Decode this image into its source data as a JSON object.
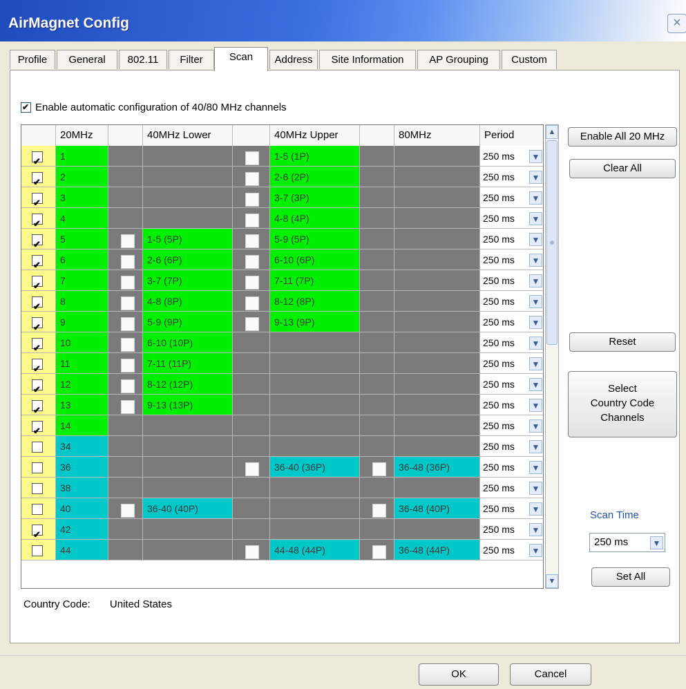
{
  "window": {
    "title": "AirMagnet Config",
    "close_glyph": "×"
  },
  "tabs": [
    {
      "label": "Profile"
    },
    {
      "label": "General"
    },
    {
      "label": "802.11"
    },
    {
      "label": "Filter"
    },
    {
      "label": "Scan",
      "active": true
    },
    {
      "label": "Address"
    },
    {
      "label": "Site Information"
    },
    {
      "label": "AP Grouping"
    },
    {
      "label": "Custom"
    }
  ],
  "scan": {
    "auto_config": {
      "label": "Enable automatic configuration of 40/80 MHz channels",
      "checked": true
    },
    "columns": [
      "20MHz",
      "40MHz Lower",
      "40MHz Upper",
      "80MHz",
      "Period"
    ],
    "rows": [
      {
        "enabled": true,
        "ch": "1",
        "lower": "",
        "upper": "1-5 (1P)",
        "mhz80": "",
        "period": "250 ms",
        "color": "green"
      },
      {
        "enabled": true,
        "ch": "2",
        "lower": "",
        "upper": "2-6 (2P)",
        "mhz80": "",
        "period": "250 ms",
        "color": "green"
      },
      {
        "enabled": true,
        "ch": "3",
        "lower": "",
        "upper": "3-7 (3P)",
        "mhz80": "",
        "period": "250 ms",
        "color": "green"
      },
      {
        "enabled": true,
        "ch": "4",
        "lower": "",
        "upper": "4-8 (4P)",
        "mhz80": "",
        "period": "250 ms",
        "color": "green"
      },
      {
        "enabled": true,
        "ch": "5",
        "lower": "1-5 (5P)",
        "upper": "5-9 (5P)",
        "mhz80": "",
        "period": "250 ms",
        "color": "green"
      },
      {
        "enabled": true,
        "ch": "6",
        "lower": "2-6 (6P)",
        "upper": "6-10 (6P)",
        "mhz80": "",
        "period": "250 ms",
        "color": "green"
      },
      {
        "enabled": true,
        "ch": "7",
        "lower": "3-7 (7P)",
        "upper": "7-11 (7P)",
        "mhz80": "",
        "period": "250 ms",
        "color": "green"
      },
      {
        "enabled": true,
        "ch": "8",
        "lower": "4-8 (8P)",
        "upper": "8-12 (8P)",
        "mhz80": "",
        "period": "250 ms",
        "color": "green"
      },
      {
        "enabled": true,
        "ch": "9",
        "lower": "5-9 (9P)",
        "upper": "9-13 (9P)",
        "mhz80": "",
        "period": "250 ms",
        "color": "green"
      },
      {
        "enabled": true,
        "ch": "10",
        "lower": "6-10 (10P)",
        "upper": "",
        "mhz80": "",
        "period": "250 ms",
        "color": "green"
      },
      {
        "enabled": true,
        "ch": "11",
        "lower": "7-11 (11P)",
        "upper": "",
        "mhz80": "",
        "period": "250 ms",
        "color": "green"
      },
      {
        "enabled": true,
        "ch": "12",
        "lower": "8-12 (12P)",
        "upper": "",
        "mhz80": "",
        "period": "250 ms",
        "color": "green"
      },
      {
        "enabled": true,
        "ch": "13",
        "lower": "9-13 (13P)",
        "upper": "",
        "mhz80": "",
        "period": "250 ms",
        "color": "green"
      },
      {
        "enabled": true,
        "ch": "14",
        "lower": "",
        "upper": "",
        "mhz80": "",
        "period": "250 ms",
        "color": "green"
      },
      {
        "enabled": false,
        "ch": "34",
        "lower": "",
        "upper": "",
        "mhz80": "",
        "period": "250 ms",
        "color": "teal"
      },
      {
        "enabled": false,
        "ch": "36",
        "lower": "",
        "upper": "36-40 (36P)",
        "mhz80": "36-48 (36P)",
        "period": "250 ms",
        "color": "teal"
      },
      {
        "enabled": false,
        "ch": "38",
        "lower": "",
        "upper": "",
        "mhz80": "",
        "period": "250 ms",
        "color": "teal"
      },
      {
        "enabled": false,
        "ch": "40",
        "lower": "36-40 (40P)",
        "upper": "",
        "mhz80": "36-48 (40P)",
        "period": "250 ms",
        "color": "teal"
      },
      {
        "enabled": true,
        "ch": "42",
        "lower": "",
        "upper": "",
        "mhz80": "",
        "period": "250 ms",
        "color": "teal"
      },
      {
        "enabled": false,
        "ch": "44",
        "lower": "",
        "upper": "44-48 (44P)",
        "mhz80": "36-48 (44P)",
        "period": "250 ms",
        "color": "teal"
      }
    ],
    "buttons": {
      "enable_all": "Enable All 20 MHz",
      "clear_all": "Clear All",
      "reset": "Reset",
      "select_country_line1": "Select",
      "select_country_line2": "Country Code",
      "select_country_line3": "Channels",
      "set_all": "Set All"
    },
    "scan_time": {
      "label": "Scan Time",
      "value": "250 ms"
    },
    "country": {
      "label": "Country Code:",
      "value": "United States"
    }
  },
  "footer": {
    "ok": "OK",
    "cancel": "Cancel"
  },
  "colors": {
    "green": "#00f000",
    "teal": "#00c8c8",
    "gray": "#7b7b7b",
    "yellow": "#fffa8c"
  },
  "icons": {
    "dropdown": "chevron-down-icon",
    "check": "check-icon"
  }
}
